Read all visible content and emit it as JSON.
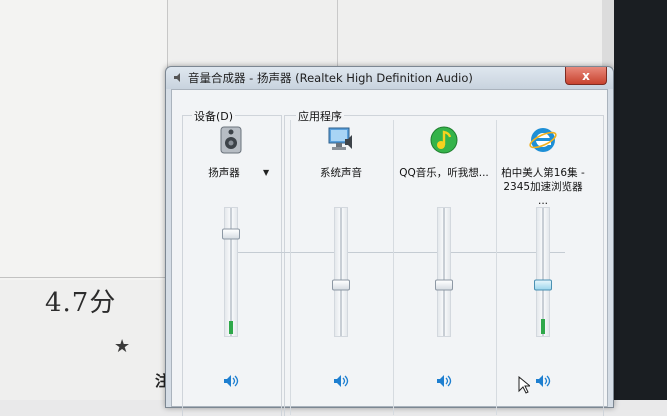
{
  "background": {
    "rating_text": "4.7分",
    "star_glyph": "★",
    "partial_char": "注"
  },
  "window": {
    "title": "音量合成器 - 扬声器 (Realtek High Definition Audio)",
    "close_glyph": "x"
  },
  "groups": {
    "device_label": "设备(D)",
    "apps_label": "应用程序"
  },
  "channels": [
    {
      "label": "扬声器",
      "icon": "speaker-device-icon",
      "volume": 0.8,
      "level": 0.1
    },
    {
      "label": "系统声音",
      "icon": "system-sounds-icon",
      "volume": 0.4,
      "level": 0
    },
    {
      "label": "QQ音乐，听我想...",
      "icon": "qq-music-icon",
      "volume": 0.4,
      "level": 0
    },
    {
      "label": "柏中美人第16集 - 2345加速浏览器 ...",
      "icon": "ie-browser-icon",
      "volume": 0.4,
      "level": 0.12
    }
  ],
  "colors": {
    "level_meter": "#2fa84a",
    "close_button": "#c8432f",
    "qq_green": "#35b34a",
    "ie_blue": "#1e8fd6"
  }
}
